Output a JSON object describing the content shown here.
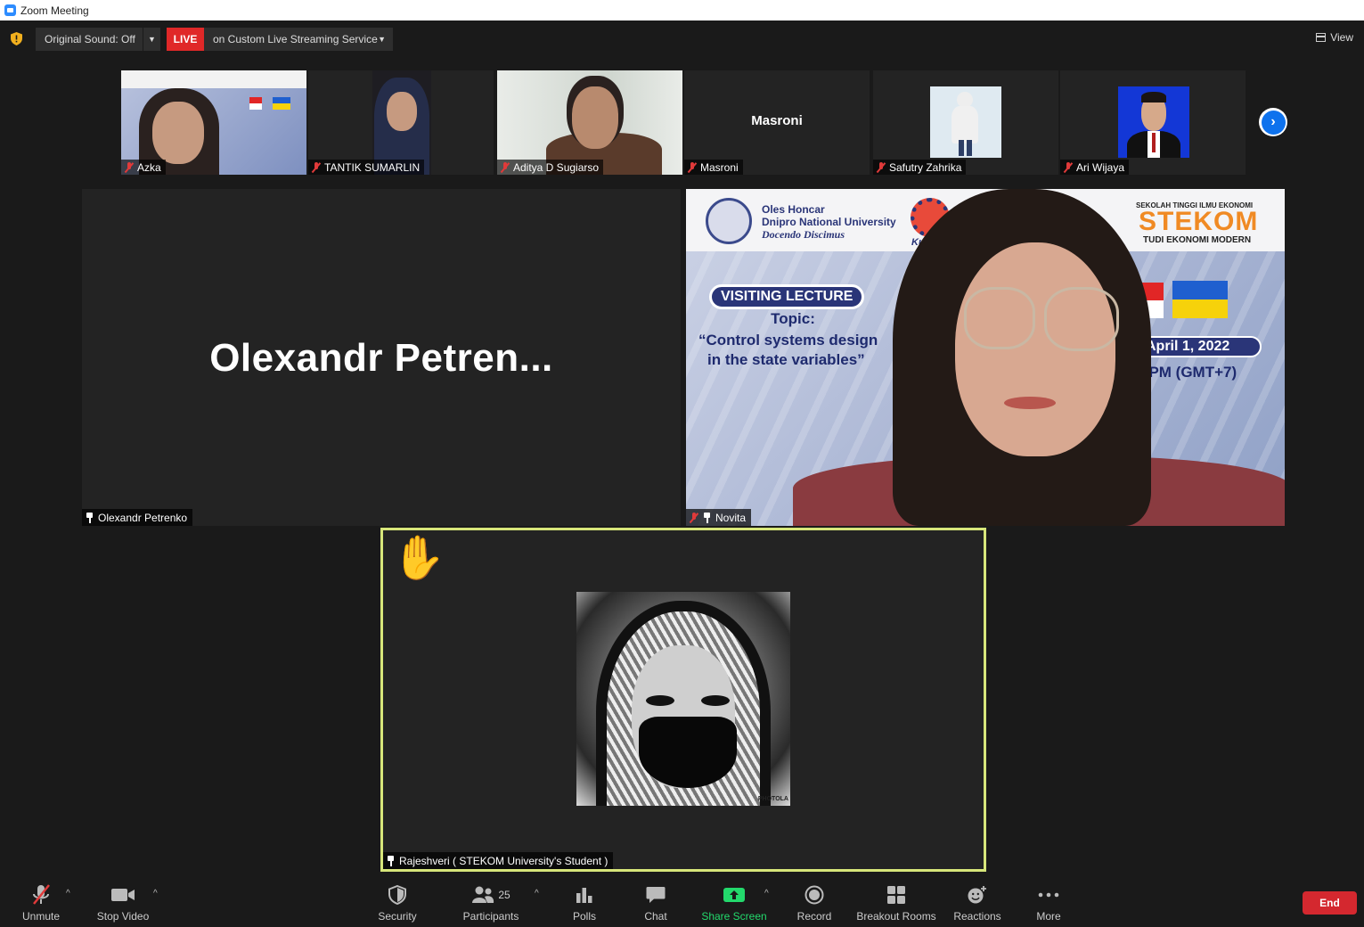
{
  "window": {
    "title": "Zoom Meeting"
  },
  "topbar": {
    "original_sound": "Original Sound: Off",
    "live_label": "LIVE",
    "live_service": "on Custom Live Streaming Service",
    "view_label": "View"
  },
  "thumbnails": [
    {
      "name": "Azka",
      "muted": true
    },
    {
      "name": "TANTIK SUMARLIN",
      "muted": true
    },
    {
      "name": "Aditya D Sugiarso",
      "muted": true
    },
    {
      "name": "Masroni",
      "muted": true,
      "display_name": "Masroni"
    },
    {
      "name": "Safutry Zahrika",
      "muted": true
    },
    {
      "name": "Ari Wijaya",
      "muted": true
    }
  ],
  "tiles": {
    "olexandr": {
      "display_name": "Olexandr  Petren...",
      "tag": "Olexandr Petrenko"
    },
    "novita": {
      "tag": "Novita",
      "slide": {
        "uni_line1": "Oles Honcar",
        "uni_line2": "Dnipro National University",
        "uni_line3": "Docendo Discimus",
        "kuliah": "Kuli",
        "stekom_top": "SEKOLAH TINGGI ILMU EKONOMI",
        "stekom_word": "STEKOM",
        "stekom_sub": "TUDI EKONOMI MODERN",
        "visiting": "VISITING LECTURE",
        "topic": "Topic:",
        "ctrl_line1": "“Control systems design",
        "ctrl_line2": "in the state variables”",
        "date": "April 1, 2022",
        "time": "4PM (GMT+7)"
      }
    },
    "rajeshveri": {
      "tag": "Rajeshveri ( STEKOM University's Student )",
      "watermark": "PHOTOLA"
    }
  },
  "toolbar": {
    "unmute": "Unmute",
    "stop_video": "Stop Video",
    "security": "Security",
    "participants": "Participants",
    "participants_count": "25",
    "polls": "Polls",
    "chat": "Chat",
    "share_screen": "Share Screen",
    "record": "Record",
    "breakout_rooms": "Breakout Rooms",
    "reactions": "Reactions",
    "more": "More",
    "end": "End"
  },
  "colors": {
    "live_red": "#e02828",
    "active_speaker_border": "#d7e67a",
    "share_green": "#23d96c",
    "end_red": "#d4282f",
    "accent_blue": "#0e72ed"
  }
}
